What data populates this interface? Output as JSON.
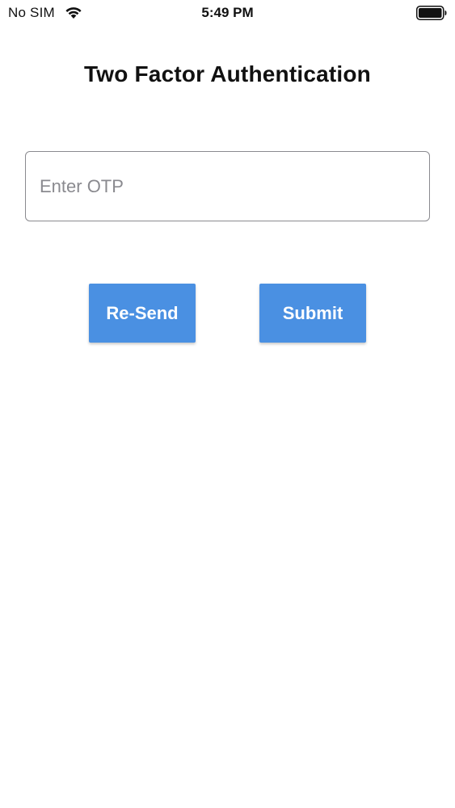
{
  "status_bar": {
    "carrier": "No SIM",
    "time": "5:49 PM",
    "wifi_icon": "wifi-icon",
    "battery_icon": "battery-icon"
  },
  "title": "Two Factor Authentication",
  "otp": {
    "placeholder": "Enter OTP",
    "value": ""
  },
  "buttons": {
    "resend_label": "Re-Send",
    "submit_label": "Submit"
  },
  "colors": {
    "button_background": "#4a90e2",
    "button_text": "#ffffff",
    "input_border": "#8a8a8f",
    "placeholder": "#8a8a8f"
  }
}
